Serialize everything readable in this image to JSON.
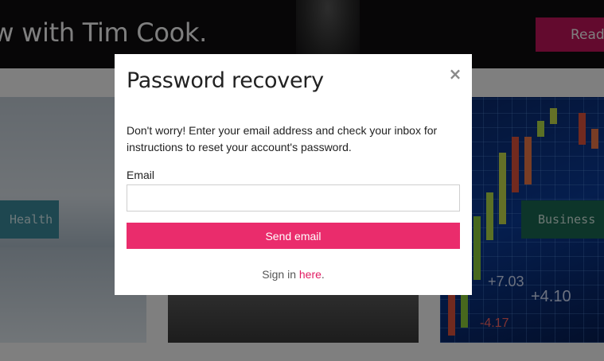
{
  "background": {
    "hero": {
      "title": "ew with Tim Cook.",
      "read_button_label": "Read"
    },
    "cards": [
      {
        "tag": "Health"
      },
      {
        "tag": "Business"
      }
    ],
    "chart_overlay_numbers": [
      "+7.03",
      "+4.10",
      "-4.17"
    ]
  },
  "modal": {
    "title": "Password recovery",
    "close_icon": "×",
    "description": "Don't worry! Enter your email address and check your inbox for instructions to reset your account's password.",
    "email_label": "Email",
    "email_value": "",
    "email_placeholder": "",
    "send_button_label": "Send email",
    "signin_prefix": "Sign in ",
    "signin_link_label": "here",
    "signin_suffix": "."
  },
  "colors": {
    "accent": "#ea2c6c",
    "link": "#e21c63",
    "hero_button": "#c7155c",
    "health_tag": "#3d8fa1",
    "business_tag": "#1a6b55"
  },
  "icons": {
    "close": "close-icon"
  }
}
